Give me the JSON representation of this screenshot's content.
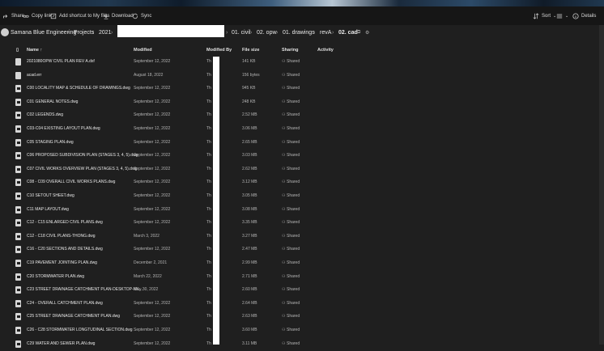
{
  "commands": {
    "share": "Share",
    "copy_link": "Copy link",
    "add_shortcut": "Add shortcut to My files",
    "download": "Download",
    "sync": "Sync",
    "sort": "Sort",
    "details": "Details"
  },
  "breadcrumb": [
    "Samana Blue Engineering",
    "Projects",
    "2021",
    "01. civil",
    "02. opw",
    "01. drawings",
    "revA",
    "02. cad"
  ],
  "columns": {
    "name": "Name ↑",
    "modified": "Modified",
    "modified_by": "Modified By",
    "file_size": "File size",
    "sharing": "Sharing",
    "activity": "Activity"
  },
  "files": [
    {
      "name": "2021080OPW CIVIL PLAN REV A.dxf",
      "modified": "September 12, 2022",
      "by": "Th",
      "size": "141 KB",
      "sharing": "Shared",
      "type": "file"
    },
    {
      "name": "acad.err",
      "modified": "August 18, 2022",
      "by": "Th",
      "size": "156 bytes",
      "sharing": "Shared",
      "type": "file"
    },
    {
      "name": "C00 LOCALITY MAP & SCHEDULE OF DRAWINGS.dwg",
      "modified": "September 12, 2022",
      "by": "Th",
      "size": "945 KB",
      "sharing": "Shared",
      "type": "dwg"
    },
    {
      "name": "C01 GENERAL NOTES.dwg",
      "modified": "September 12, 2022",
      "by": "Th",
      "size": "248 KB",
      "sharing": "Shared",
      "type": "dwg"
    },
    {
      "name": "C02 LEGENDS.dwg",
      "modified": "September 12, 2022",
      "by": "Th",
      "size": "2.52 MB",
      "sharing": "Shared",
      "type": "dwg"
    },
    {
      "name": "C03-C04 EXISTING LAYOUT PLAN.dwg",
      "modified": "September 12, 2022",
      "by": "Th",
      "size": "3.06 MB",
      "sharing": "Shared",
      "type": "dwg"
    },
    {
      "name": "C05 STAGING PLAN.dwg",
      "modified": "September 12, 2022",
      "by": "Th",
      "size": "2.65 MB",
      "sharing": "Shared",
      "type": "dwg"
    },
    {
      "name": "C06 PROPOSED SUBDIVISION PLAN (STAGES 3, 4, 5).dwg",
      "modified": "September 12, 2022",
      "by": "Th",
      "size": "3.03 MB",
      "sharing": "Shared",
      "type": "dwg"
    },
    {
      "name": "C07 CIVIL WORKS OVERVIEW PLAN (STAGES 3, 4, 5).dwg",
      "modified": "September 12, 2022",
      "by": "Th",
      "size": "2.62 MB",
      "sharing": "Shared",
      "type": "dwg"
    },
    {
      "name": "C08 - C09 OVERALL CIVIL WORKS PLANS.dwg",
      "modified": "September 12, 2022",
      "by": "Th",
      "size": "3.12 MB",
      "sharing": "Shared",
      "type": "dwg"
    },
    {
      "name": "C10 SETOUT SHEET.dwg",
      "modified": "September 12, 2022",
      "by": "Th",
      "size": "3.05 MB",
      "sharing": "Shared",
      "type": "dwg"
    },
    {
      "name": "C11 MAP LAYOUT.dwg",
      "modified": "September 12, 2022",
      "by": "Th",
      "size": "3.08 MB",
      "sharing": "Shared",
      "type": "dwg"
    },
    {
      "name": "C12 - C15 ENLARGED CIVIL PLANS.dwg",
      "modified": "September 12, 2022",
      "by": "Th",
      "size": "3.35 MB",
      "sharing": "Shared",
      "type": "dwg"
    },
    {
      "name": "C12 - C18 CIVIL PLANS-THONG.dwg",
      "modified": "March 3, 2022",
      "by": "Th",
      "size": "3.27 MB",
      "sharing": "Shared",
      "type": "dwg"
    },
    {
      "name": "C16 - C20 SECTIONS AND DETAILS.dwg",
      "modified": "September 12, 2022",
      "by": "Th",
      "size": "2.47 MB",
      "sharing": "Shared",
      "type": "dwg"
    },
    {
      "name": "C19 PAVEMENT JOINTING PLAN.dwg",
      "modified": "December 2, 2021",
      "by": "Th",
      "size": "2.99 MB",
      "sharing": "Shared",
      "type": "dwg"
    },
    {
      "name": "C20 STORMWATER PLAN.dwg",
      "modified": "March 22, 2022",
      "by": "Th",
      "size": "2.71 MB",
      "sharing": "Shared",
      "type": "dwg"
    },
    {
      "name": "C23 STREET DRAINAGE CATCHMENT PLAN-DESKTOP-NK...",
      "modified": "May 30, 2022",
      "by": "Th",
      "size": "2.60 MB",
      "sharing": "Shared",
      "type": "dwg"
    },
    {
      "name": "C24 - OVERALL CATCHMENT PLAN.dwg",
      "modified": "September 12, 2022",
      "by": "Th",
      "size": "2.64 MB",
      "sharing": "Shared",
      "type": "dwg"
    },
    {
      "name": "C25 STREET DRAINAGE CATCHMENT PLAN.dwg",
      "modified": "September 12, 2022",
      "by": "Th",
      "size": "2.63 MB",
      "sharing": "Shared",
      "type": "dwg"
    },
    {
      "name": "C26 - C28 STORMWATER LONGTUDINAL SECTION.dwg",
      "modified": "September 12, 2022",
      "by": "Th",
      "size": "3.60 MB",
      "sharing": "Shared",
      "type": "dwg"
    },
    {
      "name": "C29 WATER AND SEWER PLAN.dwg",
      "modified": "September 12, 2022",
      "by": "Th",
      "size": "3.11 MB",
      "sharing": "Shared",
      "type": "dwg"
    }
  ]
}
